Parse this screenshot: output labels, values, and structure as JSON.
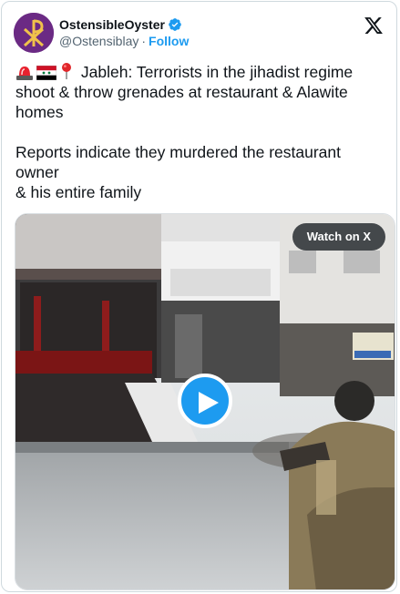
{
  "author": {
    "display_name": "OstensibleOyster",
    "handle": "@Ostensiblay",
    "separator": "·",
    "follow_label": "Follow",
    "verified": true
  },
  "tweet": {
    "line1_text": "Jableh: Terrorists in the jihadist regime shoot & throw grenades at restaurant & Alawite homes",
    "line1_emojis": [
      "police-light-icon",
      "syria-flag-icon",
      "round-pushpin-icon"
    ],
    "line2_text": "Reports indicate they murdered the restaurant owner",
    "line3_text": "& his entire family"
  },
  "media": {
    "watch_label": "Watch on X",
    "type": "video"
  },
  "colors": {
    "accent": "#1d9bf0",
    "text": "#0f1419",
    "muted": "#536471",
    "avatar_bg": "#6b2a84"
  }
}
